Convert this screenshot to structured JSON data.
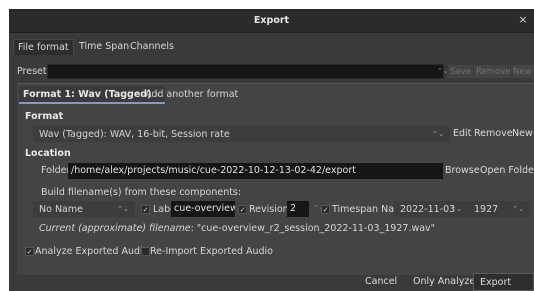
{
  "window": {
    "title": "Export",
    "close_glyph": "×"
  },
  "tabs": [
    "File format",
    "Time Span",
    "Channels"
  ],
  "preset": {
    "label": "Preset",
    "value": "",
    "buttons": [
      "Save",
      "Remove",
      "New"
    ]
  },
  "format_tabs": {
    "active": "Format 1: Wav (Tagged)",
    "close_glyph": "×",
    "add": "Add another format"
  },
  "format": {
    "heading": "Format",
    "value": "Wav (Tagged): WAV, 16-bit, Session rate",
    "buttons": [
      "Edit",
      "Remove",
      "New"
    ]
  },
  "location": {
    "heading": "Location",
    "folder_label": "Folder:",
    "folder_value": "/home/alex/projects/music/cue-2022-10-12-13-02-42/export",
    "browse": "Browse",
    "open_folder": "Open Folder"
  },
  "filename": {
    "build_label": "Build filename(s) from these components:",
    "name_value": "No Name",
    "label_check": "Label:",
    "label_value": "cue-overview",
    "revision_check": "Revision:",
    "revision_value": "2",
    "timespan_check": "Timespan Name",
    "date_value": "2022-11-03",
    "time_value": "1927",
    "current_prefix": "Current (approximate) filename",
    "current_value": ": \"cue-overview_r2_session_2022-11-03_1927.wav\""
  },
  "options": {
    "analyze": "Analyze Exported Audio",
    "reimport": "Re-Import Exported Audio"
  },
  "footer": {
    "cancel": "Cancel",
    "only_analyze": "Only Analyze",
    "export": "Export"
  },
  "colors": {
    "window_bg": "#3a3a3c",
    "titlebar_bg": "#2b2b2d",
    "field_bg": "#161617",
    "accent": "#7a9cd0"
  }
}
